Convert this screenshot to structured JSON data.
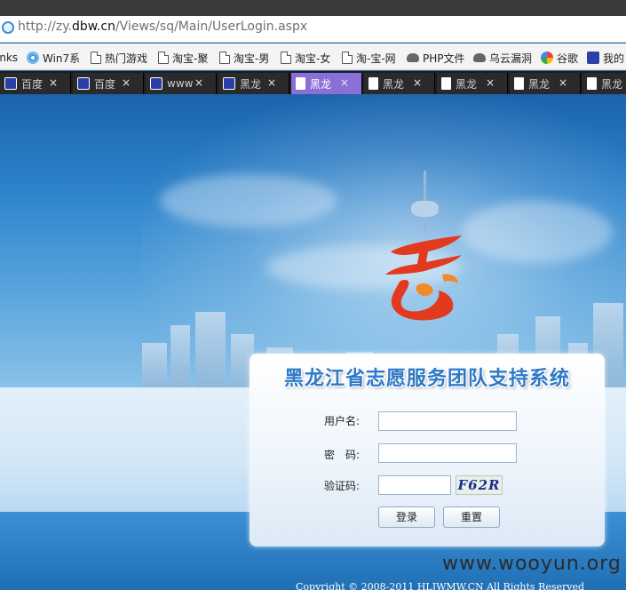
{
  "browser": {
    "url_prefix": "http://zy.",
    "url_domain": "dbw.cn",
    "url_path": "/Views/sq/Main/UserLogin.aspx"
  },
  "bookmarks": [
    {
      "label": "inks",
      "icon": "none"
    },
    {
      "label": "Win7系",
      "icon": "disc-icon"
    },
    {
      "label": "热门游戏",
      "icon": "document-icon"
    },
    {
      "label": "淘宝-聚",
      "icon": "document-icon"
    },
    {
      "label": "淘宝-男",
      "icon": "document-icon"
    },
    {
      "label": "淘宝-女",
      "icon": "document-icon"
    },
    {
      "label": "淘-宝-网",
      "icon": "document-icon"
    },
    {
      "label": "PHP文件",
      "icon": "cloud-icon"
    },
    {
      "label": "乌云漏洞",
      "icon": "cloud-icon"
    },
    {
      "label": "谷歌",
      "icon": "google-icon"
    },
    {
      "label": "我的",
      "icon": "paw-icon"
    }
  ],
  "tabs": [
    {
      "label": "百度",
      "icon": "paw-icon",
      "active": false
    },
    {
      "label": "百度",
      "icon": "paw-icon",
      "active": false
    },
    {
      "label": "www",
      "icon": "paw-icon",
      "active": false
    },
    {
      "label": "黑龙",
      "icon": "paw-icon",
      "active": false
    },
    {
      "label": "黑龙",
      "icon": "document-icon",
      "active": true
    },
    {
      "label": "黑龙",
      "icon": "document-icon",
      "active": false
    },
    {
      "label": "黑龙",
      "icon": "document-icon",
      "active": false
    },
    {
      "label": "黑龙",
      "icon": "document-icon",
      "active": false
    },
    {
      "label": "黑龙",
      "icon": "document-icon",
      "active": false
    }
  ],
  "tab_close_glyph": "×",
  "login": {
    "title": "黑龙江省志愿服务团队支持系统",
    "username_label": "用户名:",
    "username_value": "",
    "password_label": "密　码:",
    "password_value": "",
    "captcha_label": "验证码:",
    "captcha_value": "",
    "captcha_image_text": "F62R",
    "login_button": "登录",
    "reset_button": "重置"
  },
  "watermark": "www.wooyun.org",
  "footer": {
    "copyright": "Copyright © 2008-2011 HLJWMW.CN All Rights Reserved"
  },
  "colors": {
    "active_tab": "#8b6fd6",
    "title_blue": "#2e79c7",
    "logo_red": "#e13a1f",
    "page_blue": "#1f6fb5"
  }
}
